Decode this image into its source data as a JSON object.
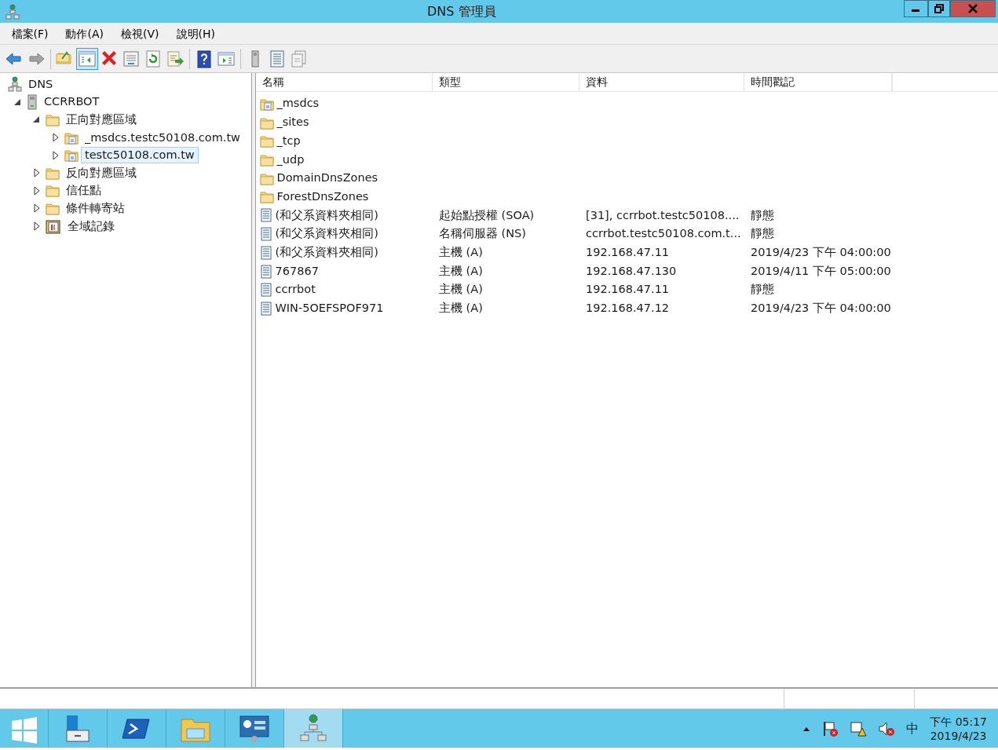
{
  "window": {
    "title": "DNS 管理員"
  },
  "menu": [
    {
      "label": "檔案(F)"
    },
    {
      "label": "動作(A)"
    },
    {
      "label": "檢視(V)"
    },
    {
      "label": "說明(H)"
    }
  ],
  "toolbar": [
    [
      {
        "kind": "back",
        "disabled": false,
        "selected": false
      },
      {
        "kind": "forward",
        "disabled": true,
        "selected": false
      }
    ],
    [
      {
        "kind": "up",
        "disabled": false,
        "selected": false
      },
      {
        "kind": "tree",
        "disabled": false,
        "selected": true
      },
      {
        "kind": "delete",
        "disabled": false,
        "selected": false
      },
      {
        "kind": "properties",
        "disabled": false,
        "selected": false
      },
      {
        "kind": "refresh",
        "disabled": false,
        "selected": false
      },
      {
        "kind": "export",
        "disabled": false,
        "selected": false
      }
    ],
    [
      {
        "kind": "help",
        "disabled": false,
        "selected": false
      },
      {
        "kind": "actionpane",
        "disabled": false,
        "selected": false
      }
    ],
    [
      {
        "kind": "server",
        "disabled": false,
        "selected": false
      },
      {
        "kind": "record",
        "disabled": false,
        "selected": false
      },
      {
        "kind": "copy",
        "disabled": false,
        "selected": false
      }
    ]
  ],
  "tree": [
    {
      "label": "DNS",
      "kind": "dns",
      "selected": false,
      "children": [
        {
          "label": "CCRRBOT",
          "kind": "server",
          "expanded": true,
          "selected": false,
          "children": [
            {
              "label": "正向對應區域",
              "kind": "folder",
              "expanded": true,
              "selected": false,
              "children": [
                {
                  "label": "_msdcs.testc50108.com.tw",
                  "kind": "zone",
                  "expanded": false,
                  "selected": false
                },
                {
                  "label": "testc50108.com.tw",
                  "kind": "zone",
                  "expanded": false,
                  "selected": true
                }
              ]
            },
            {
              "label": "反向對應區域",
              "kind": "folder",
              "expanded": false,
              "selected": false
            },
            {
              "label": "信任點",
              "kind": "folder",
              "expanded": false,
              "selected": false
            },
            {
              "label": "條件轉寄站",
              "kind": "folder",
              "expanded": false,
              "selected": false
            },
            {
              "label": "全域記錄",
              "kind": "log",
              "expanded": false,
              "selected": false
            }
          ]
        }
      ]
    }
  ],
  "table": {
    "columns": [
      "名稱",
      "類型",
      "資料",
      "時間戳記"
    ],
    "rows": [
      {
        "kind": "zone",
        "name": "_msdcs"
      },
      {
        "kind": "folder",
        "name": "_sites"
      },
      {
        "kind": "folder",
        "name": "_tcp"
      },
      {
        "kind": "folder",
        "name": "_udp"
      },
      {
        "kind": "folder",
        "name": "DomainDnsZones"
      },
      {
        "kind": "folder",
        "name": "ForestDnsZones"
      },
      {
        "kind": "record",
        "name": "(和父系資料夾相同)",
        "type": "起始點授權 (SOA)",
        "data": "[31], ccrrbot.testc50108....",
        "timestamp": "靜態"
      },
      {
        "kind": "record",
        "name": "(和父系資料夾相同)",
        "type": "名稱伺服器 (NS)",
        "data": "ccrrbot.testc50108.com.t...",
        "timestamp": "靜態"
      },
      {
        "kind": "record",
        "name": "(和父系資料夾相同)",
        "type": "主機 (A)",
        "data": "192.168.47.11",
        "timestamp": "2019/4/23 下午 04:00:00"
      },
      {
        "kind": "record",
        "name": "767867",
        "type": "主機 (A)",
        "data": "192.168.47.130",
        "timestamp": "2019/4/11 下午 05:00:00"
      },
      {
        "kind": "record",
        "name": "ccrrbot",
        "type": "主機 (A)",
        "data": "192.168.47.11",
        "timestamp": "靜態"
      },
      {
        "kind": "record",
        "name": "WIN-5OEFSPOF971",
        "type": "主機 (A)",
        "data": "192.168.47.12",
        "timestamp": "2019/4/23 下午 04:00:00"
      }
    ]
  },
  "taskbar": {
    "apps": [
      {
        "kind": "start",
        "selected": false
      },
      {
        "kind": "servermanager",
        "selected": false
      },
      {
        "kind": "powershell",
        "selected": false
      },
      {
        "kind": "explorer",
        "selected": false
      },
      {
        "kind": "controlpanel",
        "selected": false
      },
      {
        "kind": "dns",
        "selected": true
      }
    ],
    "tray": {
      "language": "中",
      "time": "下午 05:17",
      "date": "2019/4/23"
    }
  }
}
